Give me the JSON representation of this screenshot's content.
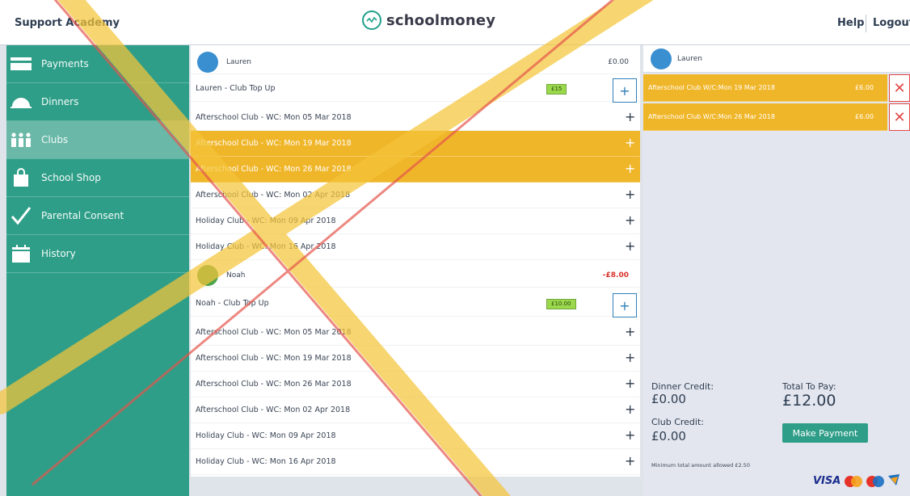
{
  "header": {
    "school_name": "Support Academy",
    "logo_text": "schoolmoney",
    "help_label": "Help",
    "logout_label": "Logout"
  },
  "sidebar": {
    "items": [
      {
        "label": "Payments",
        "icon": "card-icon"
      },
      {
        "label": "Dinners",
        "icon": "dinner-icon"
      },
      {
        "label": "Clubs",
        "icon": "clubs-icon",
        "active": true
      },
      {
        "label": "School Shop",
        "icon": "shopping-bag-icon"
      },
      {
        "label": "Parental Consent",
        "icon": "checkmark-icon"
      },
      {
        "label": "History",
        "icon": "calendar-icon"
      }
    ]
  },
  "children": [
    {
      "name": "Lauren",
      "balance": "£0.00",
      "topup_label": "Lauren - Club Top Up",
      "topup_value": "£15",
      "clubs": [
        "Afterschool Club - WC: Mon 05 Mar 2018",
        "Afterschool Club - WC: Mon 19 Mar 2018",
        "Afterschool Club - WC: Mon 26 Mar 2018",
        "Afterschool Club - WC: Mon 02 Apr 2018",
        "Holiday Club - WC: Mon 09 Apr 2018",
        "Holiday Club - WC: Mon 16 Apr 2018"
      ]
    },
    {
      "name": "Noah",
      "balance": "-£8.00",
      "topup_label": "Noah - Club Top Up",
      "topup_value": "£10.00",
      "clubs": [
        "Afterschool Club - WC: Mon 05 Mar 2018",
        "Afterschool Club - WC: Mon 19 Mar 2018",
        "Afterschool Club - WC: Mon 26 Mar 2018",
        "Afterschool Club - WC: Mon 02 Apr 2018",
        "Holiday Club - WC: Mon 09 Apr 2018",
        "Holiday Club - WC: Mon 16 Apr 2018"
      ]
    }
  ],
  "add_symbol": "+",
  "basket": {
    "child_name": "Lauren",
    "items": [
      {
        "label": "Afterschool Club W/C:Mon 19 Mar 2018",
        "price": "£6.00"
      },
      {
        "label": "Afterschool Club W/C:Mon 26 Mar 2018",
        "price": "£6.00"
      }
    ],
    "remove_symbol": "✕",
    "dinner_credit_label": "Dinner Credit:",
    "dinner_credit_value": "£0.00",
    "club_credit_label": "Club Credit:",
    "club_credit_value": "£0.00",
    "total_label": "Total To Pay:",
    "total_value": "£12.00",
    "pay_button": "Make Payment",
    "min_note": "Minimum total amount allowed £2.50",
    "card_brand": "VISA"
  },
  "colors": {
    "brand_green": "#2f9e88",
    "selected_row": "#f0b62a",
    "negative": "#d9312b",
    "remove_red": "#e24a46"
  }
}
